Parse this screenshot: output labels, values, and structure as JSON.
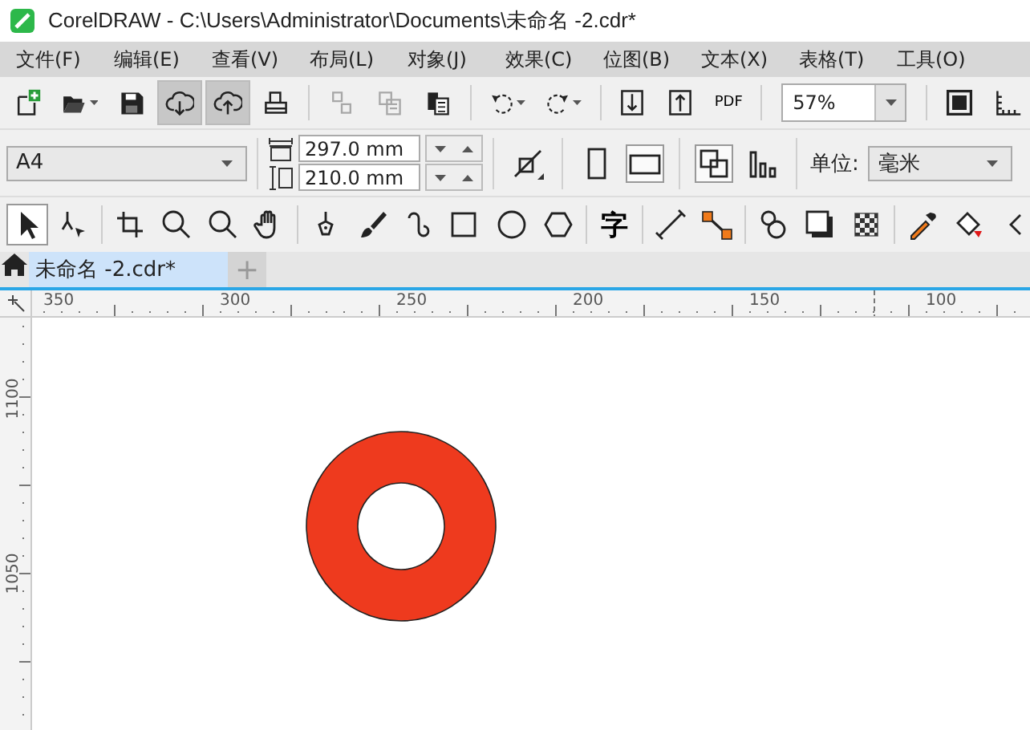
{
  "window": {
    "title": "CorelDRAW - C:\\Users\\Administrator\\Documents\\未命名 -2.cdr*"
  },
  "menu": [
    "文件(F)",
    "编辑(E)",
    "查看(V)",
    "布局(L)",
    "对象(J)",
    "效果(C)",
    "位图(B)",
    "文本(X)",
    "表格(T)",
    "工具(O)"
  ],
  "standard_toolbar": {
    "buttons": [
      {
        "pressed": false,
        "disabled": false
      },
      {
        "pressed": false,
        "disabled": false
      },
      {
        "pressed": false,
        "disabled": false
      },
      {
        "pressed": true,
        "disabled": false
      },
      {
        "pressed": true,
        "disabled": false
      },
      {
        "pressed": false,
        "disabled": false
      },
      {
        "pressed": false,
        "disabled": true
      },
      {
        "pressed": false,
        "disabled": true
      },
      {
        "pressed": false,
        "disabled": false
      },
      {
        "pressed": false,
        "disabled": false
      },
      {
        "pressed": false,
        "disabled": false
      },
      {
        "pressed": false,
        "disabled": false
      },
      {
        "pressed": false,
        "disabled": false
      },
      {
        "pressed": false,
        "disabled": false,
        "label": "PDF"
      },
      {
        "pressed": false,
        "disabled": false
      },
      {
        "pressed": false,
        "disabled": false
      }
    ],
    "zoom": "57%"
  },
  "property_bar": {
    "paper_size": "A4",
    "width": "297.0 mm",
    "height": "210.0 mm",
    "orientation": [
      {
        "selected": false
      },
      {
        "selected": true
      }
    ],
    "page_layout": [
      {
        "selected": true
      },
      {
        "selected": false
      }
    ],
    "unit_label": "单位:",
    "unit": "毫米"
  },
  "toolbox": [
    {
      "selected": true
    },
    {
      "selected": false
    },
    {
      "selected": false
    },
    {
      "selected": false
    },
    {
      "selected": false
    },
    {
      "selected": false
    },
    {
      "selected": false
    },
    {
      "selected": false
    },
    {
      "selected": false
    },
    {
      "selected": false
    },
    {
      "selected": false
    },
    {
      "selected": false
    },
    {
      "selected": false,
      "label": "字"
    },
    {
      "selected": false
    },
    {
      "selected": false
    },
    {
      "selected": false
    },
    {
      "selected": false
    },
    {
      "selected": false
    },
    {
      "selected": false
    },
    {
      "selected": false
    },
    {
      "selected": false
    }
  ],
  "tabs": [
    {
      "label": "未命名 -2.cdr*",
      "selected": true
    }
  ],
  "add_tab": "+",
  "rulers": {
    "horizontal": [
      "350",
      "300",
      "250",
      "200",
      "150",
      "100"
    ],
    "vertical": [
      "1100",
      "1050"
    ]
  }
}
